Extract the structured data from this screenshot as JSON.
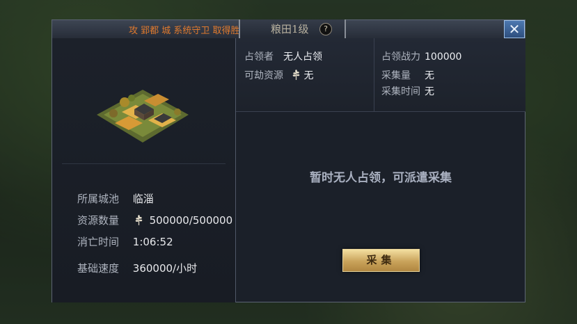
{
  "dialog": {
    "title": "粮田1级",
    "help_symbol": "?",
    "close_symbol": "✕",
    "marquee": "攻 郢都 城 系统守卫 取得胜利"
  },
  "left": {
    "rows": [
      {
        "label": "所属城池",
        "value": "临淄"
      },
      {
        "label": "资源数量",
        "value": "500000/500000",
        "icon": "grain-icon"
      },
      {
        "label": "消亡时间",
        "value": "1:06:52"
      },
      {
        "label": "基础速度",
        "value": "360000/小时"
      }
    ]
  },
  "info": {
    "occupier_label": "占领者",
    "occupier_value": "无人占领",
    "lootable_label": "可劫资源",
    "lootable_value": "无",
    "power_label": "占领战力",
    "power_value": "100000",
    "gather_amount_label": "采集量",
    "gather_amount_value": "无",
    "gather_time_label": "采集时间",
    "gather_time_value": "无"
  },
  "message": "暂时无人占领，可派遣采集",
  "collect_button": "采集",
  "colors": {
    "marquee": "#e07a2e",
    "button_gold": "#c9a35b",
    "close_blue": "#3a63a0"
  }
}
